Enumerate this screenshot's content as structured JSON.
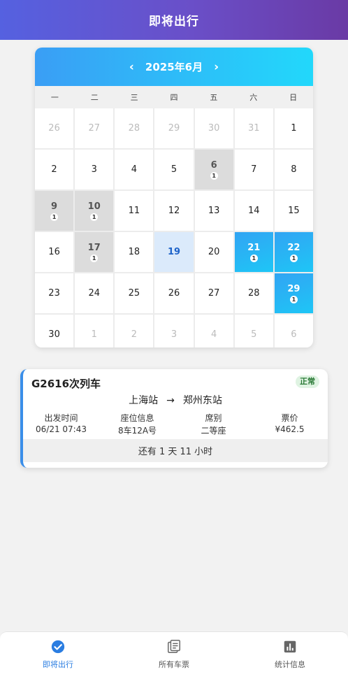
{
  "header": {
    "title": "即将出行"
  },
  "calendar": {
    "prev": "‹",
    "next": "›",
    "month": "2025年6月",
    "weekdays": [
      "一",
      "二",
      "三",
      "四",
      "五",
      "六",
      "日"
    ],
    "days": [
      {
        "d": "26",
        "type": "other"
      },
      {
        "d": "27",
        "type": "other"
      },
      {
        "d": "28",
        "type": "other"
      },
      {
        "d": "29",
        "type": "other"
      },
      {
        "d": "30",
        "type": "other"
      },
      {
        "d": "31",
        "type": "other"
      },
      {
        "d": "1",
        "type": "normal"
      },
      {
        "d": "2",
        "type": "normal"
      },
      {
        "d": "3",
        "type": "normal"
      },
      {
        "d": "4",
        "type": "normal"
      },
      {
        "d": "5",
        "type": "normal"
      },
      {
        "d": "6",
        "type": "ticket",
        "count": "1"
      },
      {
        "d": "7",
        "type": "normal"
      },
      {
        "d": "8",
        "type": "normal"
      },
      {
        "d": "9",
        "type": "ticket",
        "count": "1"
      },
      {
        "d": "10",
        "type": "ticket",
        "count": "1"
      },
      {
        "d": "11",
        "type": "normal"
      },
      {
        "d": "12",
        "type": "normal"
      },
      {
        "d": "13",
        "type": "normal"
      },
      {
        "d": "14",
        "type": "normal"
      },
      {
        "d": "15",
        "type": "normal"
      },
      {
        "d": "16",
        "type": "normal"
      },
      {
        "d": "17",
        "type": "ticket",
        "count": "1"
      },
      {
        "d": "18",
        "type": "normal"
      },
      {
        "d": "19",
        "type": "today"
      },
      {
        "d": "20",
        "type": "normal"
      },
      {
        "d": "21",
        "type": "upcoming",
        "count": "1"
      },
      {
        "d": "22",
        "type": "upcoming",
        "count": "1"
      },
      {
        "d": "23",
        "type": "normal"
      },
      {
        "d": "24",
        "type": "normal"
      },
      {
        "d": "25",
        "type": "normal"
      },
      {
        "d": "26",
        "type": "normal"
      },
      {
        "d": "27",
        "type": "normal"
      },
      {
        "d": "28",
        "type": "normal"
      },
      {
        "d": "29",
        "type": "upcoming",
        "count": "1"
      },
      {
        "d": "30",
        "type": "normal"
      },
      {
        "d": "1",
        "type": "other"
      },
      {
        "d": "2",
        "type": "other"
      },
      {
        "d": "3",
        "type": "other"
      },
      {
        "d": "4",
        "type": "other"
      },
      {
        "d": "5",
        "type": "other"
      },
      {
        "d": "6",
        "type": "other"
      }
    ]
  },
  "trip": {
    "train_no": "G2616次列车",
    "status": "正常",
    "from": "上海站",
    "arrow": "→",
    "to": "郑州东站",
    "fields": [
      {
        "label": "出发时间",
        "value": "06/21 07:43"
      },
      {
        "label": "座位信息",
        "value": "8车12A号"
      },
      {
        "label": "席别",
        "value": "二等座"
      },
      {
        "label": "票价",
        "value": "¥462.5"
      }
    ],
    "countdown": "还有 1 天 11 小时"
  },
  "nav": {
    "items": [
      {
        "label": "即将出行",
        "icon": "check-circle-icon",
        "active": true
      },
      {
        "label": "所有车票",
        "icon": "ticket-list-icon",
        "active": false
      },
      {
        "label": "统计信息",
        "icon": "bar-chart-icon",
        "active": false
      }
    ]
  },
  "colors": {
    "header_start": "#5561e0",
    "header_end": "#6a3aa5",
    "calendar_head_start": "#3a9ef5",
    "calendar_head_end": "#22d8fb",
    "accent": "#2a7de1",
    "status_green": "#2a7a36"
  }
}
